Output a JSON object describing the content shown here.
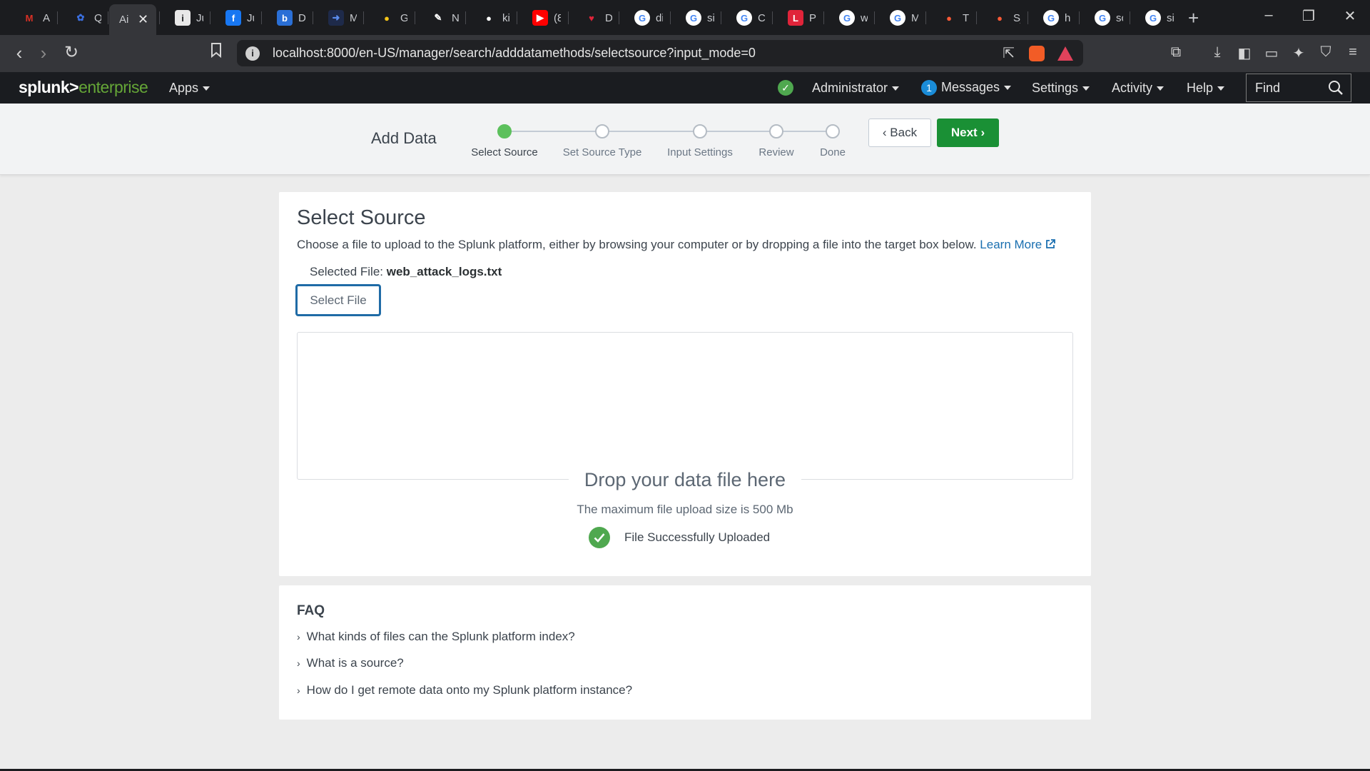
{
  "browser": {
    "tabs": [
      {
        "label": "Ai",
        "icon": "gmail-icon",
        "fav": "M",
        "color": "#d93025",
        "bg": "transparent"
      },
      {
        "label": "Q",
        "icon": "puzzle-icon",
        "fav": "✿",
        "color": "#3b6fe0",
        "bg": "transparent"
      },
      {
        "label": "Ai",
        "icon": "splunk-tab-icon",
        "fav": "",
        "color": "#ffffff",
        "bg": "transparent",
        "active": true
      },
      {
        "label": "Ju",
        "icon": "info-icon",
        "fav": "i",
        "color": "#202124",
        "bg": "#e8e8e8"
      },
      {
        "label": "Ju",
        "icon": "facebook-icon",
        "fav": "f",
        "color": "#ffffff",
        "bg": "#1877f2"
      },
      {
        "label": "D",
        "icon": "bing-icon",
        "fav": "b",
        "color": "#ffffff",
        "bg": "#2a6fd6"
      },
      {
        "label": "M",
        "icon": "arrow-app-icon",
        "fav": "➜",
        "color": "#5b8def",
        "bg": "#1e2a4a"
      },
      {
        "label": "Gi",
        "icon": "lightbulb-icon",
        "fav": "●",
        "color": "#f5c518",
        "bg": "transparent"
      },
      {
        "label": "N",
        "icon": "pen-icon",
        "fav": "✎",
        "color": "#ffffff",
        "bg": "transparent"
      },
      {
        "label": "ki",
        "icon": "github-icon",
        "fav": "●",
        "color": "#ffffff",
        "bg": "transparent"
      },
      {
        "label": "(8",
        "icon": "youtube-icon",
        "fav": "▶",
        "color": "#ffffff",
        "bg": "#ff0000"
      },
      {
        "label": "D",
        "icon": "heart-icon",
        "fav": "♥",
        "color": "#e0243a",
        "bg": "transparent"
      },
      {
        "label": "di",
        "icon": "google-icon",
        "fav": "G",
        "color": "#4285f4",
        "bg": "#ffffff"
      },
      {
        "label": "si",
        "icon": "google-icon",
        "fav": "G",
        "color": "#4285f4",
        "bg": "#ffffff"
      },
      {
        "label": "C",
        "icon": "google-icon",
        "fav": "G",
        "color": "#4285f4",
        "bg": "#ffffff"
      },
      {
        "label": "Pl",
        "icon": "l-app-icon",
        "fav": "L",
        "color": "#ffffff",
        "bg": "#e0243a"
      },
      {
        "label": "w",
        "icon": "google-icon",
        "fav": "G",
        "color": "#4285f4",
        "bg": "#ffffff"
      },
      {
        "label": "M",
        "icon": "google-icon",
        "fav": "G",
        "color": "#4285f4",
        "bg": "#ffffff"
      },
      {
        "label": "Tl",
        "icon": "orange-circle-icon",
        "fav": "●",
        "color": "#ff5a36",
        "bg": "transparent"
      },
      {
        "label": "Sj",
        "icon": "orange-circle-icon",
        "fav": "●",
        "color": "#ff5a36",
        "bg": "transparent"
      },
      {
        "label": "h",
        "icon": "google-icon",
        "fav": "G",
        "color": "#4285f4",
        "bg": "#ffffff"
      },
      {
        "label": "sc",
        "icon": "google-icon",
        "fav": "G",
        "color": "#4285f4",
        "bg": "#ffffff"
      },
      {
        "label": "si",
        "icon": "google-icon",
        "fav": "G",
        "color": "#4285f4",
        "bg": "#ffffff"
      }
    ],
    "url": "localhost:8000/en-US/manager/search/adddatamethods/selectsource?input_mode=0"
  },
  "splunk_header": {
    "logo_a": "splunk>",
    "logo_b": "enterprise",
    "apps": "Apps",
    "user": "Administrator",
    "messages_count": "1",
    "messages": "Messages",
    "settings": "Settings",
    "activity": "Activity",
    "help": "Help",
    "find": "Find"
  },
  "wizard": {
    "title": "Add Data",
    "steps": [
      "Select Source",
      "Set Source Type",
      "Input Settings",
      "Review",
      "Done"
    ],
    "current_step": 0,
    "back": "Back",
    "next": "Next"
  },
  "select_source": {
    "title": "Select Source",
    "description": "Choose a file to upload to the Splunk platform, either by browsing your computer or by dropping a file into the target box below.",
    "learn_more": "Learn More",
    "selected_file_label": "Selected File:",
    "selected_file_name": "web_attack_logs.txt",
    "select_file_button": "Select File",
    "drop_title": "Drop your data file here",
    "max_size": "The maximum file upload size is 500 Mb",
    "upload_status": "File Successfully Uploaded"
  },
  "faq": {
    "title": "FAQ",
    "items": [
      "What kinds of files can the Splunk platform index?",
      "What is a source?",
      "How do I get remote data onto my Splunk platform instance?"
    ]
  },
  "colors": {
    "splunk_green": "#65a637",
    "next_button": "#1a9035",
    "link": "#1a6fb0",
    "success": "#4fa84f"
  }
}
